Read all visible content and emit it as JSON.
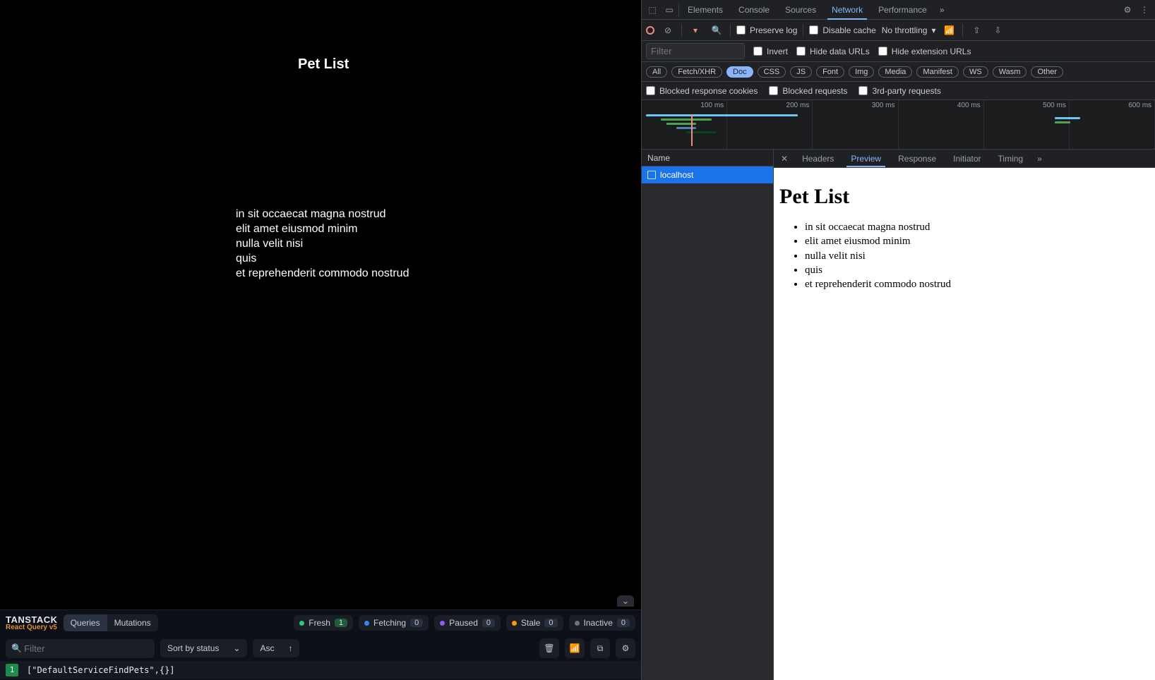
{
  "app": {
    "title": "Pet List",
    "pets": [
      "in sit occaecat magna nostrud",
      "elit amet eiusmod minim",
      "nulla velit nisi",
      "quis",
      "et reprehenderit commodo nostrud"
    ]
  },
  "rq": {
    "brand_line1": "TANSTACK",
    "brand_line2": "React Query v5",
    "tabs": {
      "queries": "Queries",
      "mutations": "Mutations"
    },
    "statuses": {
      "fresh": {
        "label": "Fresh",
        "count": "1"
      },
      "fetching": {
        "label": "Fetching",
        "count": "0"
      },
      "paused": {
        "label": "Paused",
        "count": "0"
      },
      "stale": {
        "label": "Stale",
        "count": "0"
      },
      "inactive": {
        "label": "Inactive",
        "count": "0"
      }
    },
    "filter_placeholder": "Filter",
    "sort_label": "Sort by status",
    "order_label": "Asc",
    "row": {
      "num": "1",
      "key": "[\"DefaultServiceFindPets\",{}]"
    }
  },
  "dt": {
    "tabs": [
      "Elements",
      "Console",
      "Sources",
      "Network",
      "Performance"
    ],
    "active_tab": "Network",
    "toolbar": {
      "preserve_log": "Preserve log",
      "disable_cache": "Disable cache",
      "throttling": "No throttling"
    },
    "filterbar": {
      "filter_placeholder": "Filter",
      "invert": "Invert",
      "hide_data_urls": "Hide data URLs",
      "hide_ext_urls": "Hide extension URLs"
    },
    "types": [
      "All",
      "Fetch/XHR",
      "Doc",
      "CSS",
      "JS",
      "Font",
      "Img",
      "Media",
      "Manifest",
      "WS",
      "Wasm",
      "Other"
    ],
    "active_type": "Doc",
    "blockbar": {
      "blocked_cookies": "Blocked response cookies",
      "blocked_requests": "Blocked requests",
      "third_party": "3rd-party requests"
    },
    "ticks": [
      "100 ms",
      "200 ms",
      "300 ms",
      "400 ms",
      "500 ms",
      "600 ms"
    ],
    "reqlist": {
      "header": "Name",
      "item": "localhost"
    },
    "subtabs": [
      "Headers",
      "Preview",
      "Response",
      "Initiator",
      "Timing"
    ],
    "active_subtab": "Preview",
    "preview": {
      "title": "Pet List",
      "items": [
        "in sit occaecat magna nostrud",
        "elit amet eiusmod minim",
        "nulla velit nisi",
        "quis",
        "et reprehenderit commodo nostrud"
      ]
    }
  }
}
